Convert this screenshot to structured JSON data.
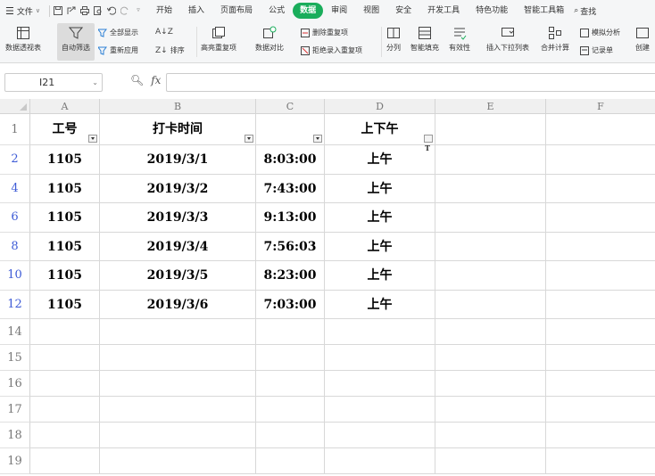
{
  "menubar": {
    "menu_icon": "hamburger-icon",
    "file_label": "文件",
    "tabs": [
      "开始",
      "插入",
      "页面布局",
      "公式",
      "数据",
      "审阅",
      "视图",
      "安全",
      "开发工具",
      "特色功能",
      "智能工具箱"
    ],
    "active_tab": "数据",
    "search_label": "查找"
  },
  "ribbon": {
    "pivot": "数据透视表",
    "autofilter": "自动筛选",
    "show_all": "全部显示",
    "reapply": "重新应用",
    "sort": "排序",
    "highlight_dup": "高亮重复项",
    "compare": "数据对比",
    "remove_dup": "删除重复项",
    "reject_dup": "拒绝录入重复项",
    "split": "分列",
    "smart_fill": "智能填充",
    "validity": "有效性",
    "dropdown": "插入下拉列表",
    "consolidate": "合并计算",
    "whatif": "模拟分析",
    "record": "记录单",
    "create": "创建"
  },
  "formula_bar": {
    "name_box": "I21",
    "fx_label": "fx",
    "formula": ""
  },
  "columns": [
    "A",
    "B",
    "C",
    "D",
    "E",
    "F"
  ],
  "header_row": {
    "row_num": "1",
    "A": "工号",
    "B": "打卡时间",
    "C": "",
    "D": "上下午"
  },
  "rows": [
    {
      "row_num": "2",
      "A": "1105",
      "B": "2019/3/1",
      "C": "8:03:00",
      "D": "上午"
    },
    {
      "row_num": "4",
      "A": "1105",
      "B": "2019/3/2",
      "C": "7:43:00",
      "D": "上午"
    },
    {
      "row_num": "6",
      "A": "1105",
      "B": "2019/3/3",
      "C": "9:13:00",
      "D": "上午"
    },
    {
      "row_num": "8",
      "A": "1105",
      "B": "2019/3/4",
      "C": "7:56:03",
      "D": "上午"
    },
    {
      "row_num": "10",
      "A": "1105",
      "B": "2019/3/5",
      "C": "8:23:00",
      "D": "上午"
    },
    {
      "row_num": "12",
      "A": "1105",
      "B": "2019/3/6",
      "C": "7:03:00",
      "D": "上午"
    }
  ],
  "empty_rows": [
    "14",
    "15",
    "16",
    "17",
    "18",
    "19"
  ],
  "colors": {
    "active_tab": "#1aad5b",
    "filtered_row_number": "#3d5bd6"
  }
}
